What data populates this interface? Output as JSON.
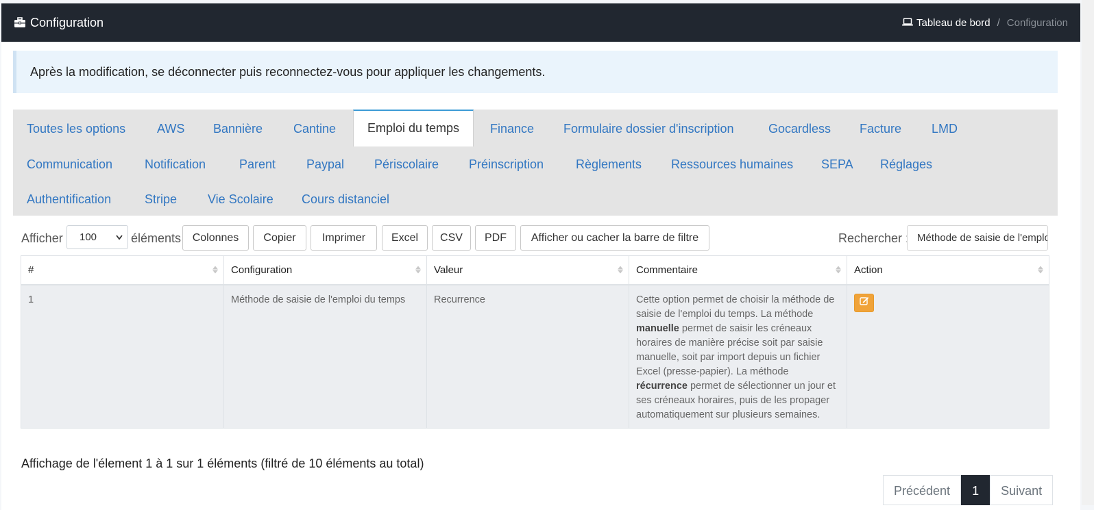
{
  "header": {
    "title": "Configuration",
    "breadcrumb": {
      "home": "Tableau de bord",
      "separator": "/",
      "current": "Configuration"
    }
  },
  "notice": "Après la modification, se déconnecter puis reconnectez-vous pour appliquer les changements.",
  "tabs": [
    {
      "label": "Toutes les options"
    },
    {
      "label": "AWS"
    },
    {
      "label": "Bannière"
    },
    {
      "label": "Cantine"
    },
    {
      "label": "Emploi du temps",
      "active": true
    },
    {
      "label": "Finance"
    },
    {
      "label": "Formulaire dossier d'inscription"
    },
    {
      "label": "Gocardless"
    },
    {
      "label": "Facture"
    },
    {
      "label": "LMD"
    },
    {
      "label": "Communication"
    },
    {
      "label": "Notification"
    },
    {
      "label": "Parent"
    },
    {
      "label": "Paypal"
    },
    {
      "label": "Périscolaire"
    },
    {
      "label": "Préinscription"
    },
    {
      "label": "Règlements"
    },
    {
      "label": "Ressources humaines"
    },
    {
      "label": "SEPA"
    },
    {
      "label": "Réglages"
    },
    {
      "label": "Authentification"
    },
    {
      "label": "Stripe"
    },
    {
      "label": "Vie Scolaire"
    },
    {
      "label": "Cours distanciel"
    }
  ],
  "toolbar": {
    "show_label": "Afficher",
    "page_size": "100",
    "elements_label": "éléments",
    "buttons": {
      "columns": "Colonnes",
      "copy": "Copier",
      "print": "Imprimer",
      "excel": "Excel",
      "csv": "CSV",
      "pdf": "PDF",
      "toggle_filter": "Afficher ou cacher la barre de filtre"
    },
    "search_label": "Rechercher :",
    "search_value": "Méthode de saisie de l'emploi du temps"
  },
  "table": {
    "columns": [
      "#",
      "Configuration",
      "Valeur",
      "Commentaire",
      "Action"
    ],
    "rows": [
      {
        "num": "1",
        "configuration": "Méthode de saisie de l'emploi du temps",
        "valeur": "Recurrence",
        "commentaire": {
          "p1": "Cette option permet de choisir la méthode de saisie de l'emploi du temps. La méthode ",
          "b1": "manuelle",
          "p2": " permet de saisir les créneaux horaires de manière précise soit par saisie manuelle, soit par import depuis un fichier Excel (presse-papier). La méthode ",
          "b2": "récurrence",
          "p3": " permet de sélectionner un jour et ses créneaux horaires, puis de les propager automatiquement sur plusieurs semaines."
        },
        "action_icon": "edit-icon"
      }
    ]
  },
  "footer": {
    "info": "Affichage de l'élement 1 à 1 sur 1 éléments (filtré de 10 éléments au total)",
    "pagination": {
      "prev": "Précédent",
      "current": "1",
      "next": "Suivant"
    }
  },
  "colors": {
    "header_bg": "#212730",
    "link": "#3277c2",
    "tab_bar_bg": "#e4e4e4",
    "notice_bg": "#eaf4fc",
    "edit_button": "#f0a33a"
  }
}
